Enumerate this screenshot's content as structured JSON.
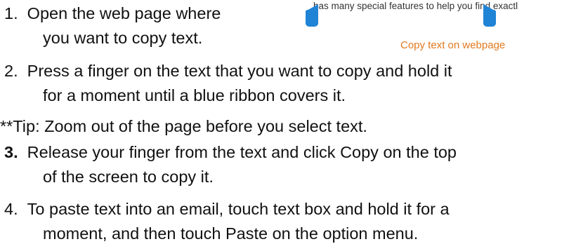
{
  "steps": [
    {
      "number": "1.",
      "lines": [
        "Open the web page where",
        "you want to copy text."
      ]
    },
    {
      "number": "2.",
      "lines": [
        "Press a finger on the text that you want to copy and hold it",
        "for a moment until a blue ribbon covers it."
      ]
    },
    {
      "number": "3.",
      "lines": [
        "Release your finger from the text and click Copy on the top",
        "of the screen to copy it."
      ]
    },
    {
      "number": "4.",
      "lines": [
        "To paste text into an email, touch text box and hold it for a",
        "moment, and then touch Paste on the option menu."
      ]
    }
  ],
  "tip": "**Tip: Zoom out of the page before you select text.",
  "inset": {
    "selected_text": "has many special features to help you find exactl",
    "caption": "Copy text on webpage",
    "caption_color": "#e07a1f",
    "handle_color": "#1f84d6"
  }
}
